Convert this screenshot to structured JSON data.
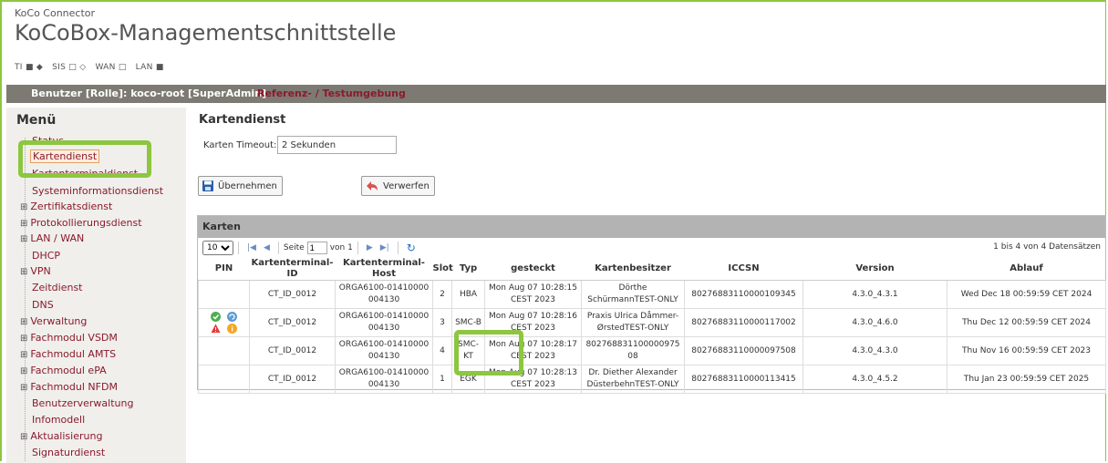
{
  "header": {
    "app_subtitle": "KoCo Connector",
    "app_title": "KoCoBox-Managementschnittstelle",
    "status": [
      {
        "label": "TI",
        "sym": "■ ◆"
      },
      {
        "label": "SIS",
        "sym": "□ ◇"
      },
      {
        "label": "WAN",
        "sym": "□"
      },
      {
        "label": "LAN",
        "sym": "■"
      }
    ]
  },
  "userbar": {
    "user": "Benutzer [Rolle]: koco-root [SuperAdmin]",
    "environment": "Referenz- / Testumgebung"
  },
  "menu": {
    "title": "Menü",
    "items": [
      {
        "label": "Status"
      },
      {
        "label": "Kartendienst"
      },
      {
        "label": "Kartenterminaldienst"
      },
      {
        "label": "Systeminformationsdienst"
      },
      {
        "label": "Zertifikatsdienst"
      },
      {
        "label": "Protokollierungsdienst"
      },
      {
        "label": "LAN / WAN"
      },
      {
        "label": "DHCP"
      },
      {
        "label": "VPN"
      },
      {
        "label": "Zeitdienst"
      },
      {
        "label": "DNS"
      },
      {
        "label": "Verwaltung"
      },
      {
        "label": "Fachmodul VSDM"
      },
      {
        "label": "Fachmodul AMTS"
      },
      {
        "label": "Fachmodul ePA"
      },
      {
        "label": "Fachmodul NFDM"
      },
      {
        "label": "Benutzerverwaltung"
      },
      {
        "label": "Infomodell"
      },
      {
        "label": "Aktualisierung"
      },
      {
        "label": "Signaturdienst"
      }
    ]
  },
  "content": {
    "title": "Kartendienst",
    "timeout_label": "Karten Timeout:",
    "timeout_value": "2 Sekunden",
    "apply_label": "Übernehmen",
    "discard_label": "Verwerfen"
  },
  "grid": {
    "title": "Karten",
    "page_size": "10",
    "page_label": "Seite",
    "page_value": "1",
    "of_label": "von 1",
    "record_info": "1 bis 4 von 4 Datensätzen",
    "columns": [
      "PIN",
      "Kartenterminal-ID",
      "Kartenterminal-Host",
      "Slot",
      "Typ",
      "gesteckt",
      "Kartenbesitzer",
      "ICCSN",
      "Version",
      "Ablauf"
    ],
    "rows": [
      {
        "pin": "",
        "terminal_id": "CT_ID_0012",
        "host": "ORGA6100-01410000004130",
        "slot": "2",
        "type": "HBA",
        "inserted": "Mon Aug 07 10:28:15 CEST 2023",
        "owner": "Dörthe SchürmannTEST-ONLY",
        "iccsn": "80276883110000109345",
        "version": "4.3.0_4.3.1",
        "expiry": "Wed Dec 18 00:59:59 CET 2024"
      },
      {
        "pin": "icons",
        "terminal_id": "CT_ID_0012",
        "host": "ORGA6100-01410000004130",
        "slot": "3",
        "type": "SMC-B",
        "inserted": "Mon Aug 07 10:28:16 CEST 2023",
        "owner": "Praxis Ulrica Dåmmer-ØrstedTEST-ONLY",
        "iccsn": "80276883110000117002",
        "version": "4.3.0_4.6.0",
        "expiry": "Thu Dec 12 00:59:59 CET 2024"
      },
      {
        "pin": "",
        "terminal_id": "CT_ID_0012",
        "host": "ORGA6100-01410000004130",
        "slot": "4",
        "type": "SMC-KT",
        "inserted": "Mon Aug 07 10:28:17 CEST 2023",
        "owner": "80276883110000097508",
        "iccsn": "80276883110000097508",
        "version": "4.3.0_4.3.0",
        "expiry": "Thu Nov 16 00:59:59 CET 2023"
      },
      {
        "pin": "",
        "terminal_id": "CT_ID_0012",
        "host": "ORGA6100-01410000004130",
        "slot": "1",
        "type": "EGK",
        "inserted": "Mon Aug 07 10:28:13 CEST 2023",
        "owner": "Dr. Diether Alexander DüsterbehnTEST-ONLY",
        "iccsn": "80276883110000113415",
        "version": "4.3.0_4.5.2",
        "expiry": "Thu Jan 23 00:59:59 CET 2025"
      }
    ]
  },
  "colors": {
    "accent_green": "#8dc63f",
    "menu_link": "#8b1a2b",
    "userbar": "#7d7a73"
  },
  "icons": [
    "save-icon",
    "undo-icon",
    "first-page-icon",
    "prev-page-icon",
    "next-page-icon",
    "last-page-icon",
    "refresh-icon",
    "check-icon",
    "refresh-small-icon",
    "warning-icon",
    "info-icon"
  ]
}
